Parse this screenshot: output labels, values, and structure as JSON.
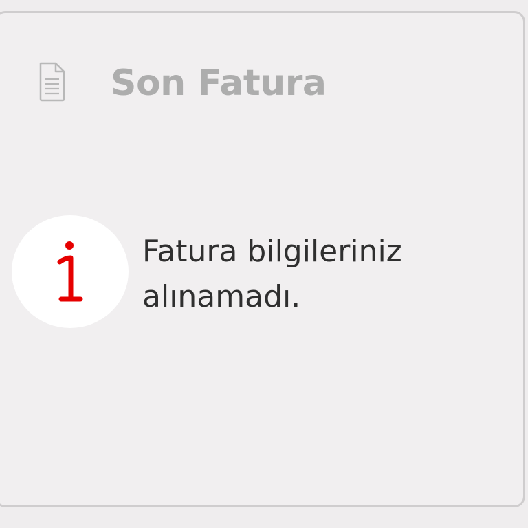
{
  "card": {
    "title": "Son Fatura",
    "header_icon": "document-icon",
    "status_icon": "info-icon",
    "message": "Fatura bilgileriniz alınamadı."
  },
  "colors": {
    "background": "#efedee",
    "card_background": "#f1eff0",
    "card_border": "#cfcdce",
    "title": "#adadad",
    "message": "#2f2f2f",
    "accent_red": "#e60000"
  }
}
